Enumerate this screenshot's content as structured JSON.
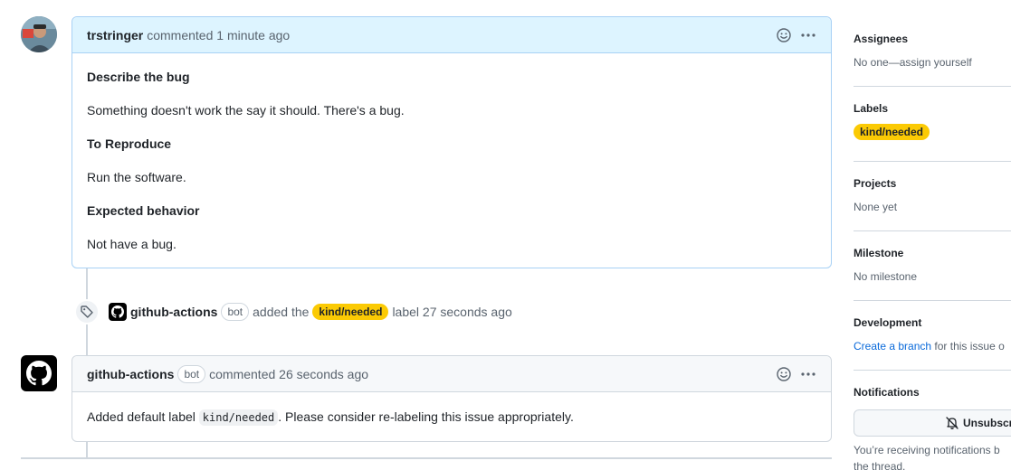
{
  "comments": [
    {
      "author": "trstringer",
      "meta": "commented 1 minute ago",
      "body": {
        "heading1": "Describe the bug",
        "para1": "Something doesn't work the say it should. There's a bug.",
        "heading2": "To Reproduce",
        "para2": "Run the software.",
        "heading3": "Expected behavior",
        "para3": "Not have a bug."
      }
    },
    {
      "author": "github-actions",
      "badge": "bot",
      "meta": "commented 26 seconds ago",
      "body": {
        "prefix": "Added default label",
        "code": "kind/needed",
        "suffix": ". Please consider re-labeling this issue appropriately."
      }
    }
  ],
  "event": {
    "actor": "github-actions",
    "badge": "bot",
    "action": "added the",
    "label": "kind/needed",
    "suffix": "label 27 seconds ago"
  },
  "sidebar": {
    "assignees": {
      "title": "Assignees",
      "value": "No one—assign yourself"
    },
    "labels": {
      "title": "Labels",
      "label": "kind/needed"
    },
    "projects": {
      "title": "Projects",
      "value": "None yet"
    },
    "milestone": {
      "title": "Milestone",
      "value": "No milestone"
    },
    "development": {
      "title": "Development",
      "link": "Create a branch",
      "value": " for this issue o"
    },
    "notifications": {
      "title": "Notifications",
      "button": "Unsubscr",
      "text": "You’re receiving notifications b the thread."
    }
  },
  "colors": {
    "label": "#fbca04",
    "author_header": "#ddf4ff",
    "link": "#0969da"
  }
}
